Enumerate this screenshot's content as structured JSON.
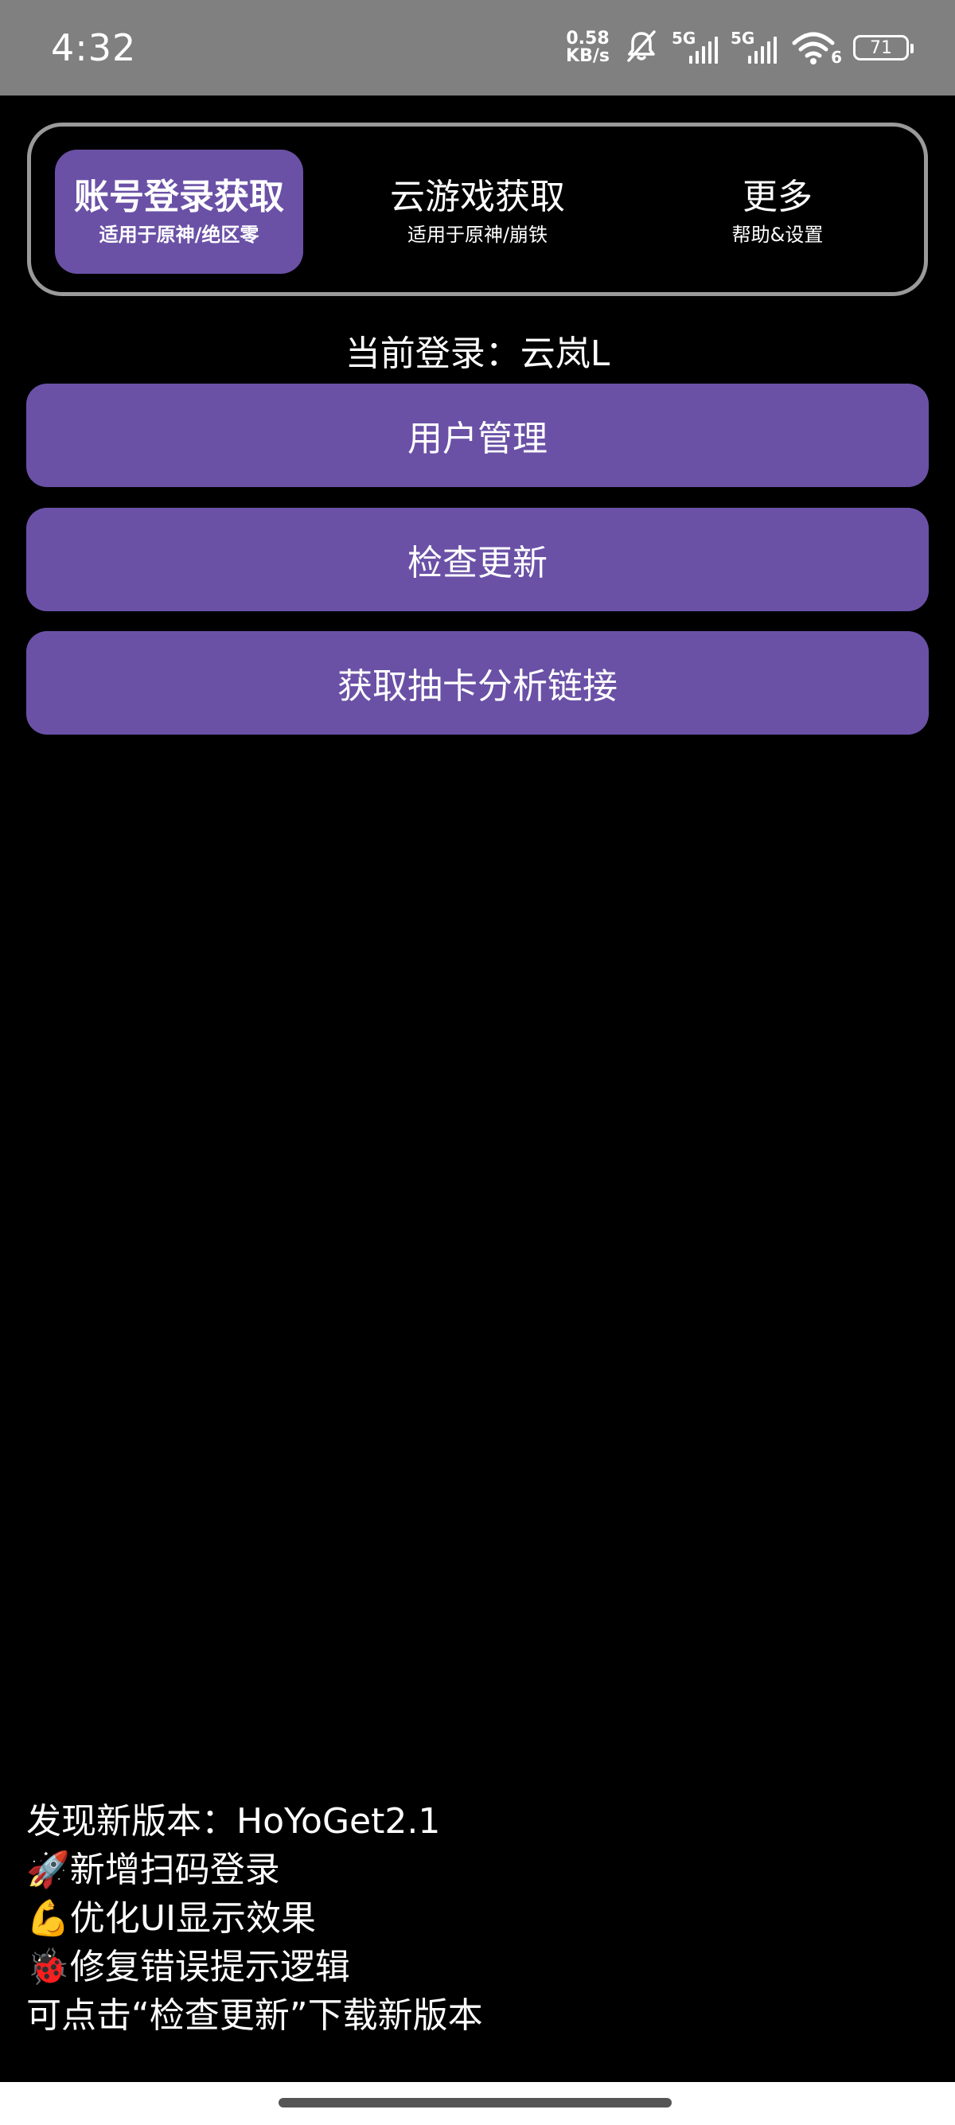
{
  "status_bar": {
    "time": "4:32",
    "net_speed_value": "0.58",
    "net_speed_unit": "KB/s",
    "sim1_type": "5G",
    "sim2_type": "5G",
    "wifi_badge": "6",
    "battery": "71"
  },
  "tabs": [
    {
      "title": "账号登录获取",
      "subtitle": "适用于原神/绝区零",
      "active": true
    },
    {
      "title": "云游戏获取",
      "subtitle": "适用于原神/崩铁",
      "active": false
    },
    {
      "title": "更多",
      "subtitle": "帮助&设置",
      "active": false
    }
  ],
  "current_login": "当前登录：云岚L",
  "buttons": {
    "user_management": "用户管理",
    "check_update": "检查更新",
    "get_gacha_link": "获取抽卡分析链接"
  },
  "update_notice": {
    "line1": "发现新版本：HoYoGet2.1",
    "line2": "🚀新增扫码登录",
    "line3": "💪优化UI显示效果",
    "line4": "🐞修复错误提示逻辑",
    "line5": "可点击“检查更新”下载新版本"
  },
  "colors": {
    "accent": "#6a51a6",
    "background": "#000000",
    "status_bar": "#808080"
  }
}
